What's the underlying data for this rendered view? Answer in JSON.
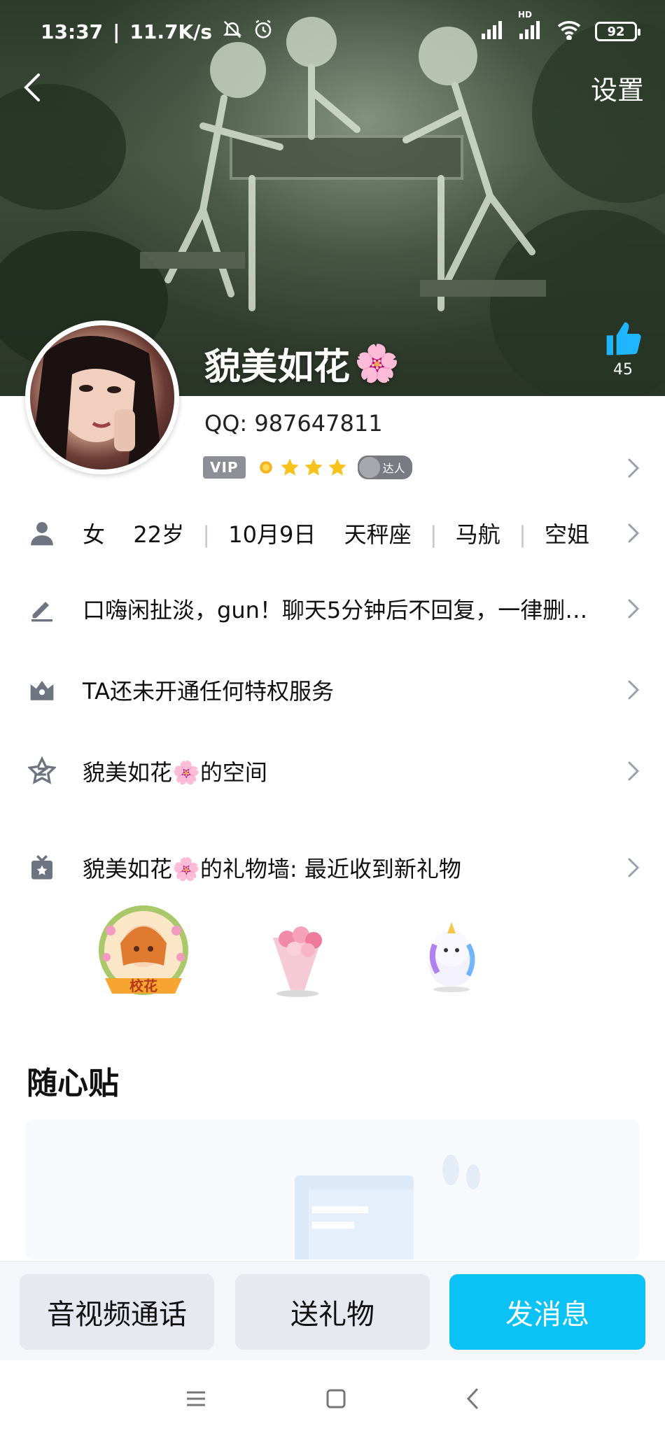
{
  "status_bar": {
    "time": "13:37",
    "speed": "11.7K/s",
    "hd_label": "HD",
    "battery": "92"
  },
  "nav": {
    "settings_label": "设置"
  },
  "cover": {
    "like_count": "45"
  },
  "profile": {
    "nickname": "貌美如花",
    "nickname_emoji": "🌸",
    "qq": "QQ: 987647811",
    "vip_label": "VIP",
    "talent_label": "达人"
  },
  "info_row": {
    "gender": "女",
    "age": "22岁",
    "birthday": "10月9日",
    "zodiac": "天秤座",
    "company": "马航",
    "job": "空姐"
  },
  "signature_row": {
    "text": "口嗨闲扯淡，gun！聊天5分钟后不回复，一律删…"
  },
  "privilege_row": {
    "text": "TA还未开通任何特权服务"
  },
  "space_row": {
    "name": "貌美如花",
    "emoji": "🌸",
    "suffix": "的空间"
  },
  "gift_row": {
    "name": "貌美如花",
    "emoji": "🌸",
    "suffix": "的礼物墙: 最近收到新礼物"
  },
  "gifts": {
    "badge_label": "校花"
  },
  "sticky": {
    "title": "随心贴"
  },
  "actions": {
    "call_label": "音视频通话",
    "gift_label": "送礼物",
    "message_label": "发消息"
  },
  "colors": {
    "accent": "#0ac2f5",
    "chevron": "#9aa0aa",
    "icon": "#6e7480"
  }
}
